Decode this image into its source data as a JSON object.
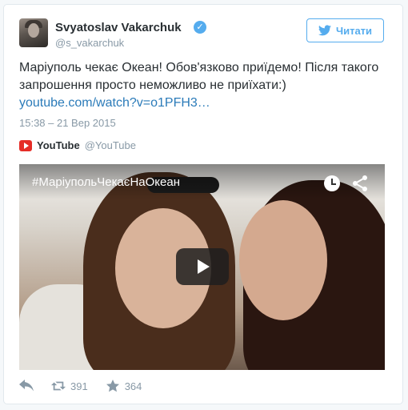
{
  "author": {
    "name": "Svyatoslav Vakarchuk",
    "handle": "@s_vakarchuk",
    "verified_mark": "✓"
  },
  "follow_button": {
    "label": "Читати",
    "icon": "twitter-bird-icon"
  },
  "tweet": {
    "text": "Маріуполь чекає Океан! Обов'язково приїдемо! Після такого запрошення просто неможливо не приїхати:)",
    "link": "youtube.com/watch?v=o1PFH3…",
    "timestamp": "15:38 – 21 Вер 2015"
  },
  "source": {
    "name": "YouTube",
    "handle": "@YouTube"
  },
  "video": {
    "title": "#МаріупольЧекаєНаОкеан"
  },
  "stats": {
    "retweets": "391",
    "likes": "364"
  },
  "colors": {
    "accent": "#55acee",
    "link": "#2b7bb9",
    "youtube_red": "#e52d27"
  }
}
